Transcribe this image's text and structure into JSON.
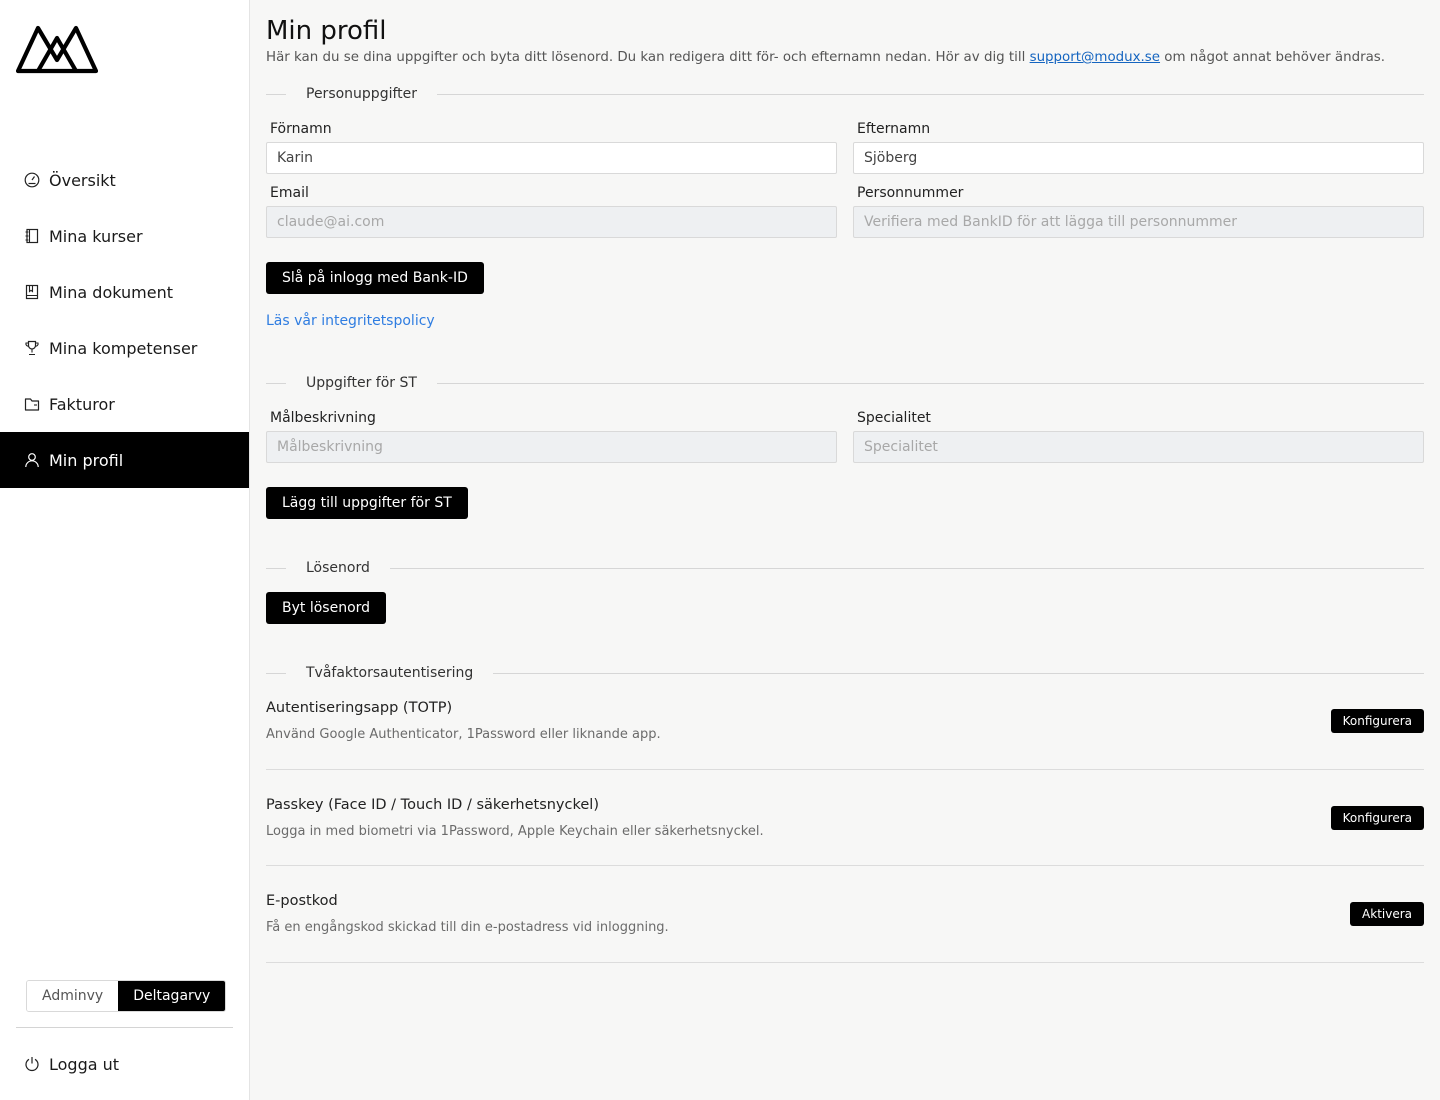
{
  "sidebar": {
    "items": [
      {
        "label": "Översikt",
        "icon": "dashboard-icon"
      },
      {
        "label": "Mina kurser",
        "icon": "notebook-icon"
      },
      {
        "label": "Mina dokument",
        "icon": "document-icon"
      },
      {
        "label": "Mina kompetenser",
        "icon": "trophy-icon"
      },
      {
        "label": "Fakturor",
        "icon": "folder-icon"
      },
      {
        "label": "Min profil",
        "icon": "user-icon",
        "active": true
      }
    ],
    "view_toggle": {
      "admin": "Adminvy",
      "participant": "Deltagarvy",
      "selected": "Deltagarvy"
    },
    "logout": "Logga ut"
  },
  "header": {
    "title": "Min profil",
    "description_before": "Här kan du se dina uppgifter och byta ditt lösenord. Du kan redigera ditt för- och efternamn nedan. Hör av dig till ",
    "support_email": "support@modux.se",
    "description_after": " om något annat behöver ändras."
  },
  "personal": {
    "section_title": "Personuppgifter",
    "first_name_label": "Förnamn",
    "first_name_value": "Karin",
    "last_name_label": "Efternamn",
    "last_name_value": "Sjöberg",
    "email_label": "Email",
    "email_value": "claude@ai.com",
    "ssn_label": "Personnummer",
    "ssn_placeholder": "Verifiera med BankID för att lägga till personnummer",
    "bankid_button": "Slå på inlogg med Bank-ID",
    "privacy_link": "Läs vår integritetspolicy"
  },
  "st": {
    "section_title": "Uppgifter för ST",
    "goal_label": "Målbeskrivning",
    "goal_placeholder": "Målbeskrivning",
    "specialty_label": "Specialitet",
    "specialty_placeholder": "Specialitet",
    "add_button": "Lägg till uppgifter för ST"
  },
  "password": {
    "section_title": "Lösenord",
    "change_button": "Byt lösenord"
  },
  "two_factor": {
    "section_title": "Tvåfaktorsautentisering",
    "methods": [
      {
        "title": "Autentiseringsapp (TOTP)",
        "description": "Använd Google Authenticator, 1Password eller liknande app.",
        "button": "Konfigurera"
      },
      {
        "title": "Passkey (Face ID / Touch ID / säkerhetsnyckel)",
        "description": "Logga in med biometri via 1Password, Apple Keychain eller säkerhetsnyckel.",
        "button": "Konfigurera"
      },
      {
        "title": "E-postkod",
        "description": "Få en engångskod skickad till din e-postadress vid inloggning.",
        "button": "Aktivera"
      }
    ]
  },
  "colors": {
    "accent": "#000000",
    "link": "#2f7de1",
    "email_link": "#1565c0"
  }
}
